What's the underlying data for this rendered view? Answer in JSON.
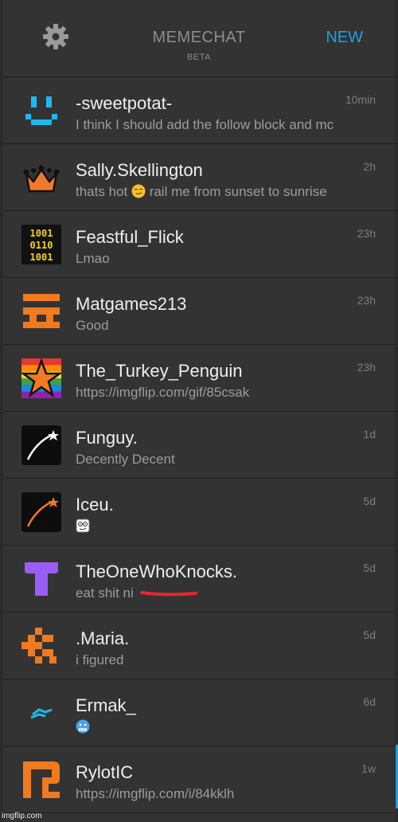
{
  "header": {
    "title": "MEMECHAT",
    "subtitle": "BETA",
    "new_label": "NEW",
    "settings_icon": "gear-icon",
    "accent": "#1aa3e8"
  },
  "conversations": [
    {
      "name": "-sweetpotat-",
      "message": "I think I should add the follow block and mc",
      "time": "10min",
      "avatar": "blue-smiley-icon"
    },
    {
      "name": "Sally.Skellington",
      "message": "thats hot",
      "message2": "rail me from sunset to sunrise",
      "time": "2h",
      "avatar": "crown-icon",
      "emoji": "smirk-emoji"
    },
    {
      "name": "Feastful_Flick",
      "message": "Lmao",
      "time": "23h",
      "avatar": "binary-icon"
    },
    {
      "name": "Matgames213",
      "message": "Good",
      "time": "23h",
      "avatar": "orange-glyph-icon"
    },
    {
      "name": "The_Turkey_Penguin",
      "message": "https://imgflip.com/gif/85csak",
      "time": "23h",
      "avatar": "rainbow-star-icon"
    },
    {
      "name": "Funguy.",
      "message": "Decently Decent",
      "time": "1d",
      "avatar": "white-shooting-star-icon"
    },
    {
      "name": "Iceu.",
      "message": "",
      "time": "5d",
      "avatar": "orange-shooting-star-icon",
      "emoji": "rage-face-emoji"
    },
    {
      "name": "TheOneWhoKnocks.",
      "message": "eat shit ni",
      "time": "5d",
      "avatar": "purple-t-icon",
      "redacted": true
    },
    {
      "name": ".Maria.",
      "message": "i figured",
      "time": "5d",
      "avatar": "orange-blocks-icon"
    },
    {
      "name": "Ermak_",
      "message": "",
      "time": "6d",
      "avatar": "blue-lightning-icon",
      "emoji": "cold-face-emoji"
    },
    {
      "name": "RylotIC",
      "message": "https://imgflip.com/i/84kklh",
      "time": "1w",
      "avatar": "orange-r-icon"
    }
  ],
  "watermark": "imgflip.com"
}
